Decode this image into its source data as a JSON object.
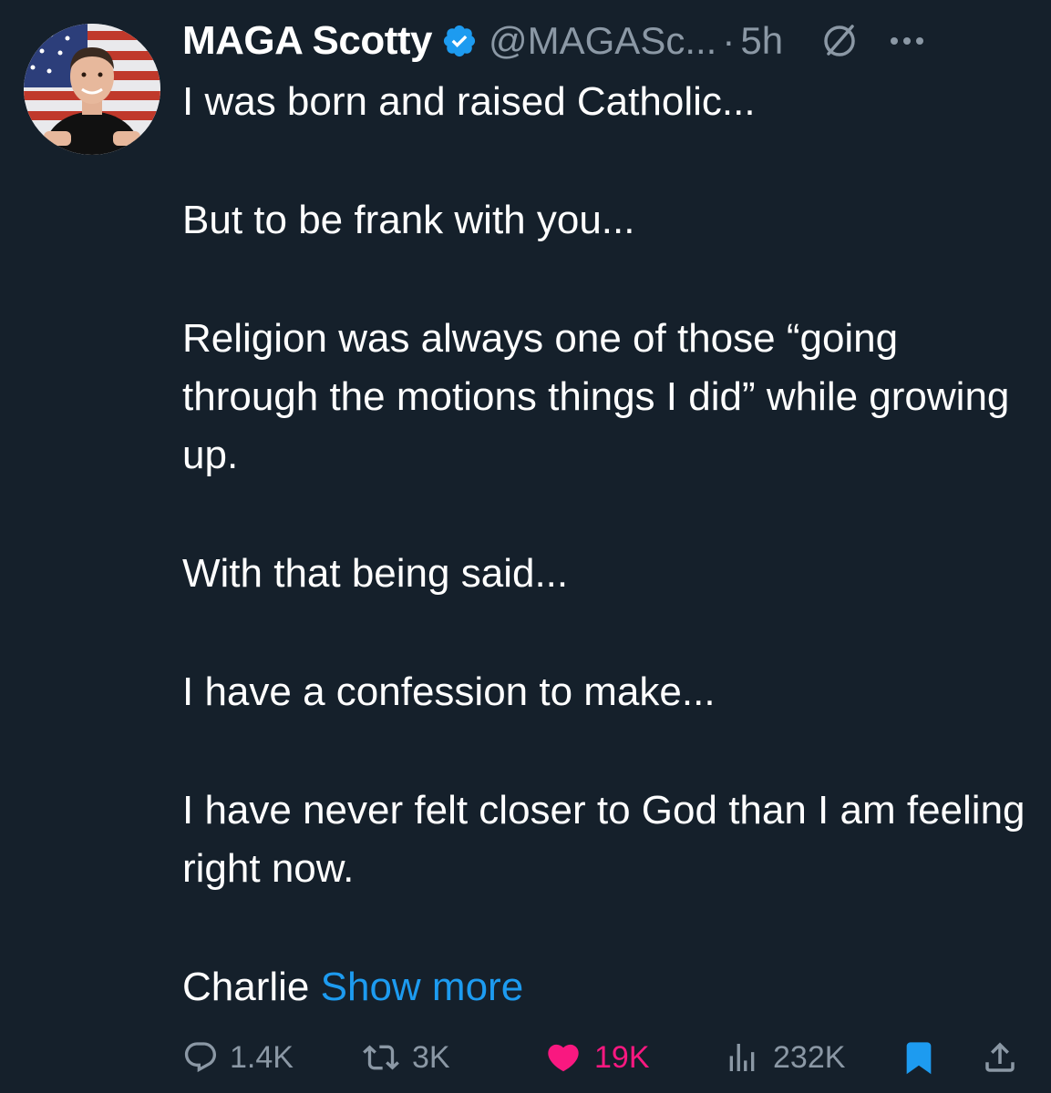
{
  "author": {
    "name": "MAGA Scotty",
    "handle": "@MAGASc...",
    "separator": "·",
    "time": "5h",
    "verified_color": "#1d9bf0"
  },
  "post": {
    "paragraphs": [
      "I was born and raised Catholic...",
      "But to be frank with you...",
      "Religion was always one of those “going through the motions things I did” while growing up.",
      "With that being said...",
      "I have a confession to make...",
      "I have never felt closer to God than I am feeling right now."
    ],
    "last_line": "Charlie",
    "show_more": "Show more"
  },
  "actions": {
    "replies": "1.4K",
    "reposts": "3K",
    "likes": "19K",
    "views": "232K",
    "liked": true,
    "bookmarked": true
  },
  "icons": [
    "verified-badge-icon",
    "grok-icon",
    "more-icon",
    "reply-icon",
    "repost-icon",
    "heart-icon",
    "views-icon",
    "bookmark-icon",
    "share-icon"
  ],
  "colors": {
    "background": "#15202b",
    "text": "#ffffff",
    "muted": "#8b98a5",
    "accent": "#1d9bf0",
    "like": "#f91880"
  }
}
